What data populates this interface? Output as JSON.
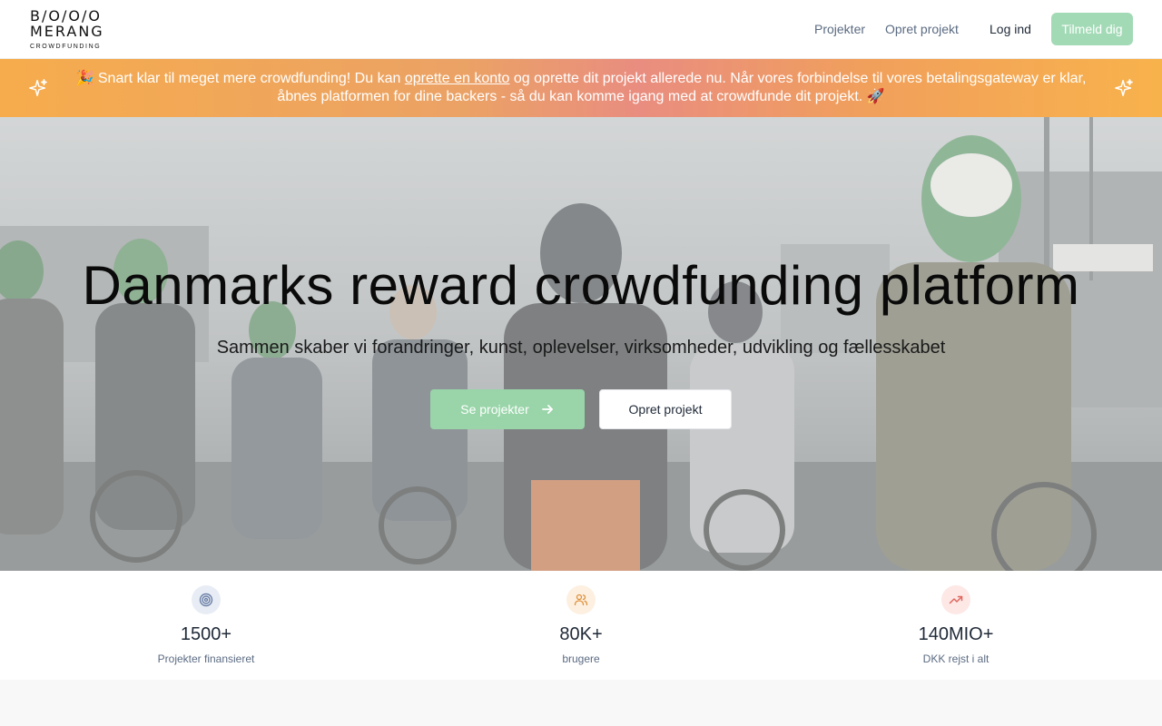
{
  "header": {
    "logo_line1": "B/O/O/O",
    "logo_line2": "MERANG",
    "logo_line3": "CROWDFUNDING",
    "nav": {
      "projects": "Projekter",
      "create_project": "Opret projekt",
      "login": "Log ind",
      "signup": "Tilmeld dig"
    }
  },
  "banner": {
    "text_before_link": "🎉 Snart klar til meget mere crowdfunding! Du kan ",
    "link_text": "oprette en konto",
    "text_after_link": " og oprette dit projekt allerede nu. Når vores forbindelse til vores betalingsgateway er klar, åbnes platformen for dine backers - så du kan komme igang med at crowdfunde dit projekt. 🚀",
    "sparkle_icon": "sparkle-icon"
  },
  "hero": {
    "title": "Danmarks reward crowdfunding platform",
    "subtitle": "Sammen skaber vi forandringer, kunst, oplevelser, virksomheder, udvikling og fællesskabet",
    "see_projects_label": "Se projekter",
    "create_project_label": "Opret projekt",
    "arrow_icon": "arrow-right-icon"
  },
  "stats": [
    {
      "value": "1500+",
      "label": "Projekter finansieret",
      "icon": "target-icon",
      "color": "#6b7fa6",
      "bg": "#e8edf5"
    },
    {
      "value": "80K+",
      "label": "brugere",
      "icon": "users-icon",
      "color": "#e0913c",
      "bg": "#fdf0e1"
    },
    {
      "value": "140MIO+",
      "label": "DKK rejst i alt",
      "icon": "trending-up-icon",
      "color": "#e0675f",
      "bg": "#fde8e6"
    }
  ],
  "colors": {
    "primary_green": "#a3dab6",
    "banner_orange": "#f6ac4c",
    "banner_pink": "#e98d80",
    "muted_text": "#5b6b82"
  }
}
